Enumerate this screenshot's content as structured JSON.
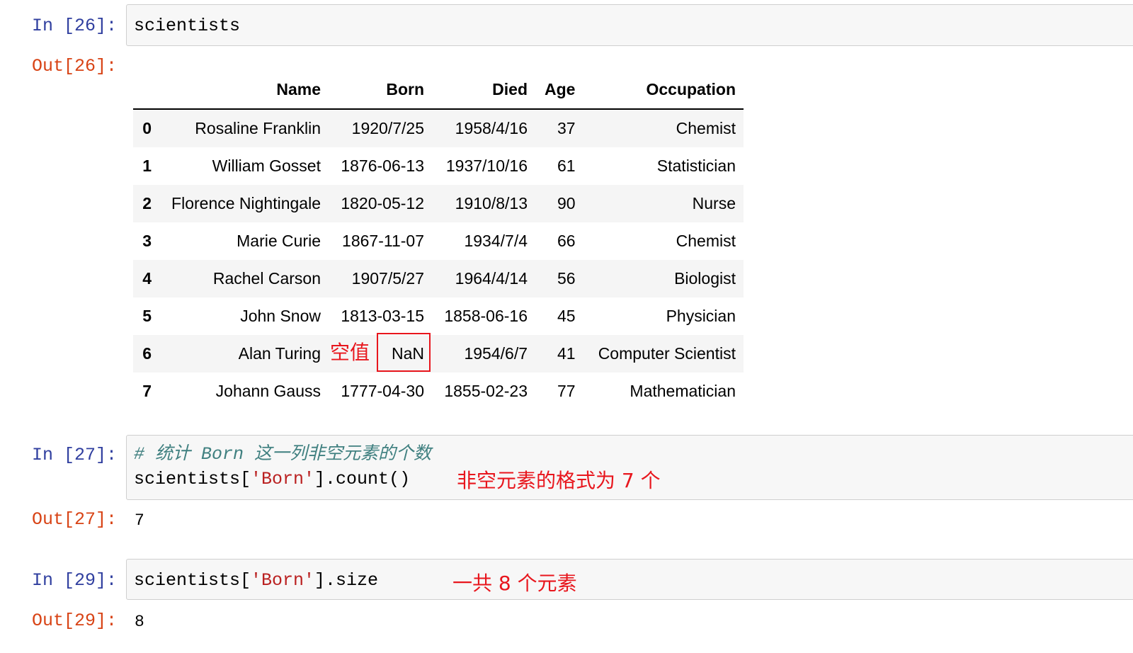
{
  "cells": [
    {
      "in_prompt": "In [26]:",
      "code_lines": [
        "scientists"
      ],
      "out_prompt": "Out[26]:",
      "dataframe": {
        "columns": [
          "Name",
          "Born",
          "Died",
          "Age",
          "Occupation"
        ],
        "rows": [
          {
            "index": "0",
            "Name": "Rosaline Franklin",
            "Born": "1920/7/25",
            "Died": "1958/4/16",
            "Age": "37",
            "Occupation": "Chemist"
          },
          {
            "index": "1",
            "Name": "William Gosset",
            "Born": "1876-06-13",
            "Died": "1937/10/16",
            "Age": "61",
            "Occupation": "Statistician"
          },
          {
            "index": "2",
            "Name": "Florence Nightingale",
            "Born": "1820-05-12",
            "Died": "1910/8/13",
            "Age": "90",
            "Occupation": "Nurse"
          },
          {
            "index": "3",
            "Name": "Marie Curie",
            "Born": "1867-11-07",
            "Died": "1934/7/4",
            "Age": "66",
            "Occupation": "Chemist"
          },
          {
            "index": "4",
            "Name": "Rachel Carson",
            "Born": "1907/5/27",
            "Died": "1964/4/14",
            "Age": "56",
            "Occupation": "Biologist"
          },
          {
            "index": "5",
            "Name": "John Snow",
            "Born": "1813-03-15",
            "Died": "1858-06-16",
            "Age": "45",
            "Occupation": "Physician"
          },
          {
            "index": "6",
            "Name": "Alan Turing",
            "Born": "NaN",
            "Died": "1954/6/7",
            "Age": "41",
            "Occupation": "Computer Scientist"
          },
          {
            "index": "7",
            "Name": "Johann Gauss",
            "Born": "1777-04-30",
            "Died": "1855-02-23",
            "Age": "77",
            "Occupation": "Mathematician"
          }
        ]
      },
      "annotation": "空值"
    },
    {
      "in_prompt": "In [27]:",
      "comment": "# 统计 Born 这一列非空元素的个数",
      "code_prefix": "scientists[",
      "code_string": "'Born'",
      "code_suffix": "].count()",
      "annotation": "非空元素的格式为 7 个",
      "out_prompt": "Out[27]:",
      "output": "7"
    },
    {
      "in_prompt": "In [29]:",
      "code_prefix": "scientists[",
      "code_string": "'Born'",
      "code_suffix": "].size",
      "annotation": "一共 8 个元素",
      "out_prompt": "Out[29]:",
      "output": "8"
    }
  ],
  "colors": {
    "in_prompt": "#303f9f",
    "out_prompt": "#d84315",
    "annotation": "#e8161d",
    "comment": "#408080",
    "string": "#ba2121",
    "input_bg": "#f7f7f7"
  }
}
